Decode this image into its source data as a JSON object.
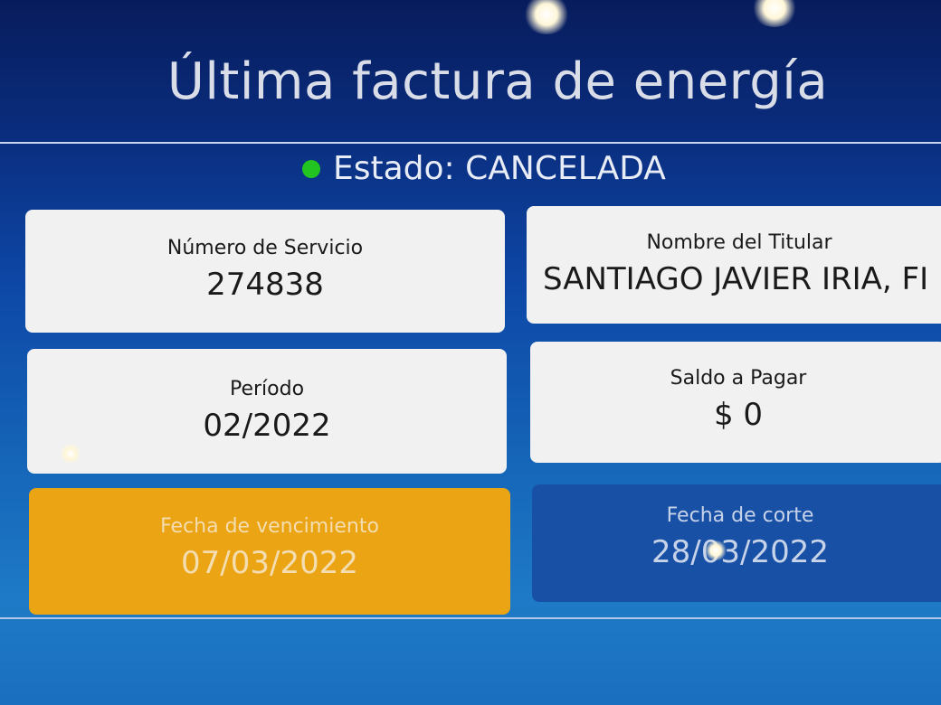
{
  "header": {
    "title": "Última factura de energía"
  },
  "status": {
    "text": "Estado: CANCELADA",
    "indicator_color": "#21c421"
  },
  "cards": {
    "service_number": {
      "label": "Número de Servicio",
      "value": "274838"
    },
    "holder_name": {
      "label": "Nombre del Titular",
      "value": "SANTIAGO JAVIER IRIA, FI"
    },
    "period": {
      "label": "Período",
      "value": "02/2022"
    },
    "balance_due": {
      "label": "Saldo a Pagar",
      "value": "$ 0"
    },
    "due_date": {
      "label": "Fecha de vencimiento",
      "value": "07/03/2022",
      "color": "#eaa414"
    },
    "cutoff_date": {
      "label": "Fecha de corte",
      "value": "28/03/2022",
      "color": "#1850a6"
    }
  }
}
